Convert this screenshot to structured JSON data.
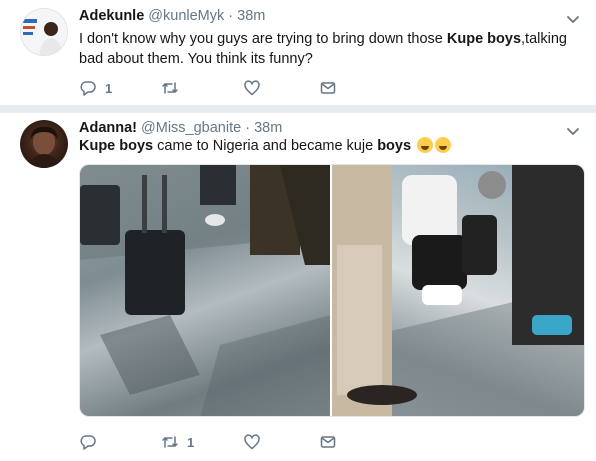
{
  "tweets": [
    {
      "name": "Adekunle",
      "handle": "@kunleMyk",
      "separator": "·",
      "time": "38m",
      "text_parts": {
        "p1": "I don't know why you guys are trying to bring down those ",
        "bold1": "Kupe boys",
        "p2": ",talking bad about them. You think its funny?"
      },
      "actions": {
        "reply_count": "1",
        "retweet_count": "",
        "like_count": ""
      }
    },
    {
      "name": "Adanna!",
      "handle": "@Miss_gbanite",
      "separator": "·",
      "time": "38m",
      "text_parts": {
        "bold1": "Kupe boys",
        "p1": " came to Nigeria and became kuje ",
        "bold2": "boys"
      },
      "emojis": [
        "face-with-tears-of-joy-icon",
        "face-with-tears-of-joy-icon"
      ],
      "media": [
        "photo-airport-luggage",
        "photo-people-sitting-floor"
      ],
      "actions": {
        "reply_count": "",
        "retweet_count": "1",
        "like_count": ""
      }
    }
  ],
  "colors": {
    "secondary_text": "#657786",
    "primary_text": "#14171a",
    "background": "#e6ecf0",
    "card": "#ffffff"
  }
}
